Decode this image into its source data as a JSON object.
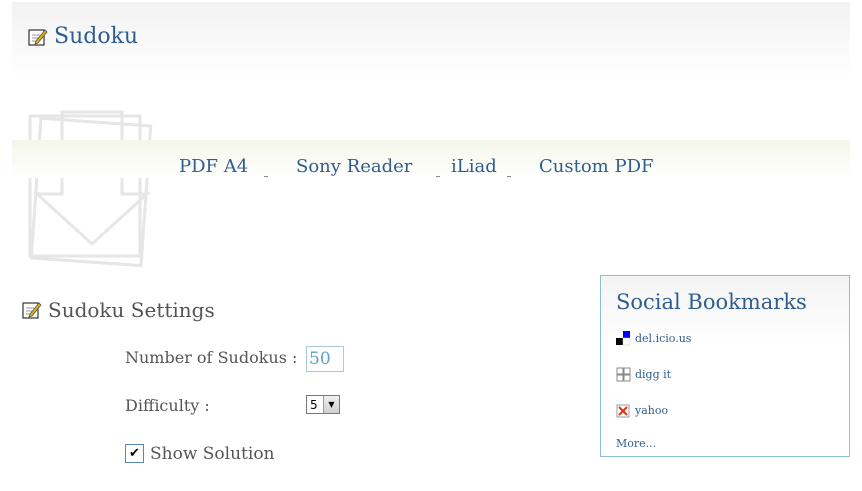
{
  "header": {
    "title": "Sudoku"
  },
  "nav": {
    "items": [
      {
        "label": "PDF A4"
      },
      {
        "label": "Sony Reader"
      },
      {
        "label": "iLiad"
      },
      {
        "label": "Custom PDF"
      }
    ]
  },
  "settings": {
    "title": "Sudoku Settings",
    "number_label": "Number of Sudokus :",
    "number_value": "50",
    "difficulty_label": "Difficulty :",
    "difficulty_value": "5",
    "show_solution_label": "Show Solution",
    "show_solution_checked": true
  },
  "bookmarks": {
    "title": "Social Bookmarks",
    "items": [
      {
        "label": "del.icio.us",
        "icon": "delicious-icon"
      },
      {
        "label": "digg it",
        "icon": "digg-icon"
      },
      {
        "label": "yahoo",
        "icon": "yahoo-icon"
      }
    ],
    "more": "More..."
  },
  "colors": {
    "link": "#2f5d8f",
    "text": "#555555",
    "box_border": "#8ec0cf"
  }
}
